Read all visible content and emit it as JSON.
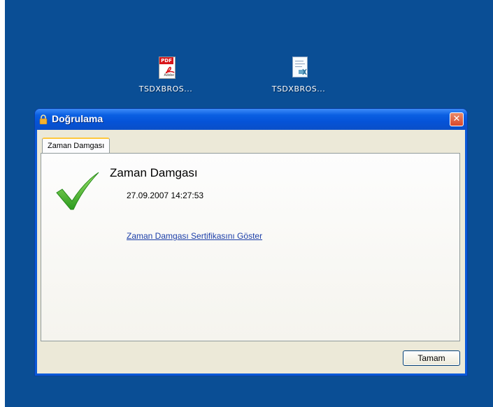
{
  "desktop": {
    "icons": [
      {
        "label": "TSDXBROS...",
        "icon": "pdf-file-icon"
      },
      {
        "label": "TSDXBROS...",
        "icon": "signed-document-icon"
      }
    ]
  },
  "dialog": {
    "title": "Doğrulama",
    "tabs": [
      {
        "label": "Zaman Damgası"
      }
    ],
    "panel": {
      "heading": "Zaman Damgası",
      "datetime": "27.09.2007 14:27:53",
      "link": "Zaman Damgası Sertifikasını Göster"
    },
    "ok_label": "Tamam",
    "close_label": "✕"
  },
  "colors": {
    "desktop": "#0a4e95",
    "titlebar": "#0a5fe2",
    "close": "#d9472a",
    "check": "#3fbb2b",
    "link": "#1c3ea8"
  }
}
